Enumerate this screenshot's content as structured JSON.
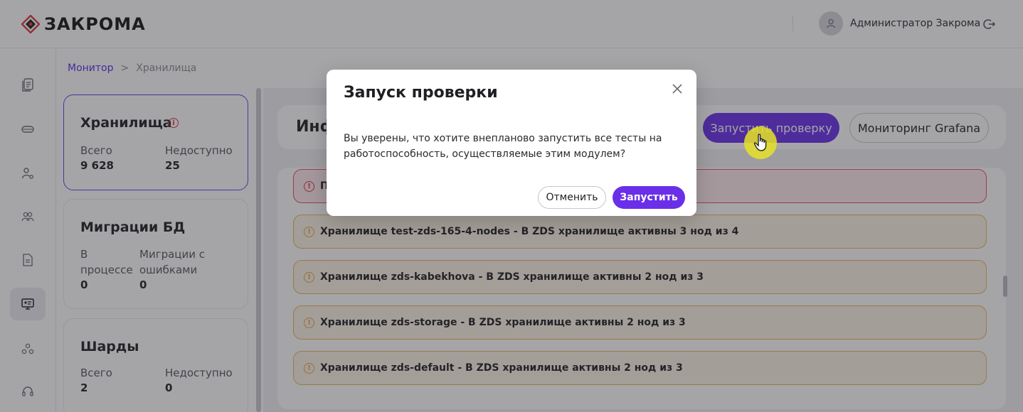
{
  "header": {
    "logo_text": "ЗАКРОМА",
    "user_name": "Администратор Закрома"
  },
  "sidebar": {
    "items": [
      {
        "icon": "documents-icon"
      },
      {
        "icon": "storage-icon"
      },
      {
        "icon": "user-settings-icon"
      },
      {
        "icon": "users-icon"
      },
      {
        "icon": "file-icon"
      },
      {
        "icon": "monitor-icon",
        "active": true
      },
      {
        "icon": "network-icon"
      },
      {
        "icon": "support-icon"
      }
    ]
  },
  "breadcrumb": {
    "link": "Монитор",
    "separator": ">",
    "current": "Хранилища"
  },
  "cards": [
    {
      "title": "Хранилища",
      "label1": "Всего",
      "value1": "9 628",
      "label2": "Недоступно",
      "value2": "25"
    },
    {
      "title": "Миграции БД",
      "label1a": "В",
      "label1b": "процессе",
      "value1": "0",
      "label2a": "Миграции с",
      "label2b": "ошибками",
      "value2": "0"
    },
    {
      "title": "Шарды",
      "label1": "Всего",
      "value1": "2",
      "label2": "Недоступно",
      "value2": "0"
    }
  ],
  "main": {
    "info_title": "Инф",
    "run_check_label": "Запустить проверку",
    "grafana_label": "Мониторинг Grafana",
    "alerts": [
      {
        "type": "error",
        "text": "П"
      },
      {
        "type": "warn",
        "text": "Хранилище test-zds-165-4-nodes - В ZDS хранилище активны 3 нод из 4"
      },
      {
        "type": "warn",
        "text": "Хранилище zds-kabekhova - В ZDS хранилище активны 2 нод из 3"
      },
      {
        "type": "warn",
        "text": "Хранилище zds-storage - В ZDS хранилище активны 2 нод из 3"
      },
      {
        "type": "warn",
        "text": "Хранилище zds-default - В ZDS хранилище активны 2 нод из 3"
      }
    ]
  },
  "modal": {
    "title": "Запуск проверки",
    "text": "Вы уверены, что хотите внепланово запустить все тесты на работоспособность, осуществляемые этим модулем?",
    "cancel_label": "Отменить",
    "confirm_label": "Запустить"
  },
  "colors": {
    "accent": "#6a2fe8",
    "error": "#e0313c",
    "warning": "#e6a23c"
  }
}
